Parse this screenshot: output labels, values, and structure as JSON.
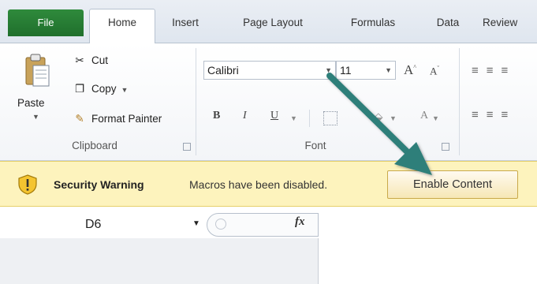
{
  "tabs": [
    {
      "label": "File"
    },
    {
      "label": "Home"
    },
    {
      "label": "Insert"
    },
    {
      "label": "Page Layout"
    },
    {
      "label": "Formulas"
    },
    {
      "label": "Data"
    },
    {
      "label": "Review"
    }
  ],
  "clipboard": {
    "paste_label": "Paste",
    "cut_label": "Cut",
    "copy_label": "Copy",
    "format_painter_label": "Format Painter",
    "group_label": "Clipboard"
  },
  "font": {
    "font_name": "Calibri",
    "font_size": "11",
    "grow_glyph": "A",
    "shrink_glyph": "A",
    "bold_glyph": "B",
    "italic_glyph": "I",
    "underline_glyph": "U",
    "color_glyph": "A",
    "group_label": "Font"
  },
  "security_bar": {
    "title": "Security Warning",
    "message": "Macros have been disabled.",
    "button_label": "Enable Content"
  },
  "formula_bar": {
    "name_box": "D6",
    "fx_label": "fx"
  },
  "colors": {
    "file_tab": "#2f8a3c",
    "warning_bar": "#fdf3bd",
    "arrow": "#2f7f7a"
  }
}
